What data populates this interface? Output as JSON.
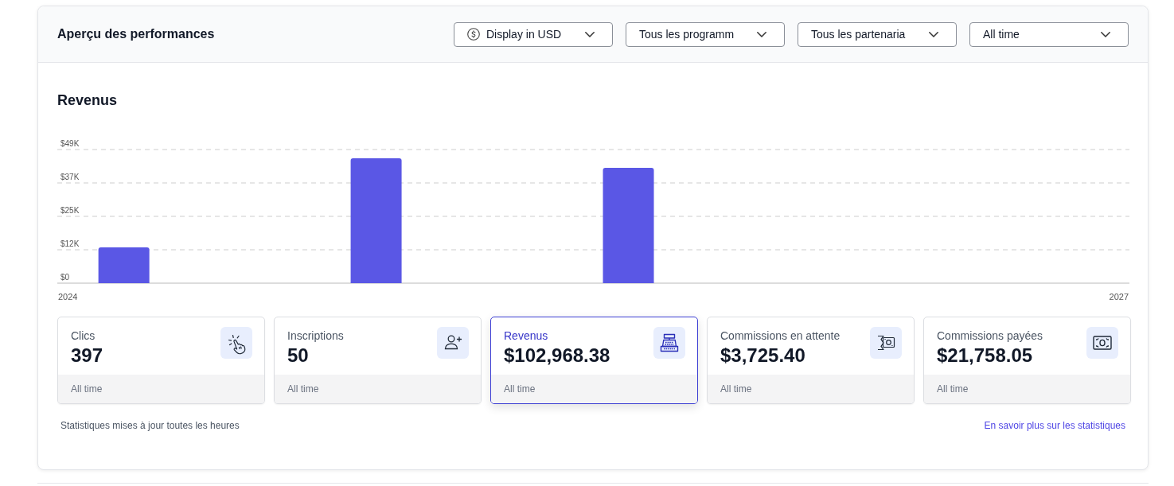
{
  "header": {
    "title": "Aperçu des performances",
    "filters": [
      {
        "kind": "currency",
        "label": "Display in USD"
      },
      {
        "kind": "select",
        "label": "Tous les programm"
      },
      {
        "kind": "select",
        "label": "Tous les partenaria"
      },
      {
        "kind": "select",
        "label": "All time"
      }
    ]
  },
  "revenue_chart": {
    "chart_data": {
      "type": "bar",
      "title": "Revenus",
      "x": [
        2024.16,
        2024.88,
        2025.6
      ],
      "values": [
        13100,
        45800,
        42300
      ],
      "xlim": [
        2023.97,
        2027.03
      ],
      "ylim": [
        0,
        49000
      ],
      "xticks": [
        {
          "value": 2024,
          "label": "2024"
        },
        {
          "value": 2027,
          "label": "2027"
        }
      ],
      "yticks": [
        {
          "value": 0,
          "label": "$0"
        },
        {
          "value": 12250,
          "label": "$12K"
        },
        {
          "value": 24500,
          "label": "$25K"
        },
        {
          "value": 36750,
          "label": "$37K"
        },
        {
          "value": 49000,
          "label": "$49K"
        }
      ],
      "grid": true
    }
  },
  "stats": [
    {
      "label": "Clics",
      "value": "397",
      "period": "All time",
      "selected": false
    },
    {
      "label": "Inscriptions",
      "value": "50",
      "period": "All time",
      "selected": false
    },
    {
      "label": "Revenus",
      "value": "$102,968.38",
      "period": "All time",
      "selected": true
    },
    {
      "label": "Commissions en attente",
      "value": "$3,725.40",
      "period": "All time",
      "selected": false
    },
    {
      "label": "Commissions payées",
      "value": "$21,758.05",
      "period": "All time",
      "selected": false
    }
  ],
  "footer": {
    "note": "Statistiques mises à jour toutes les heures",
    "link": "En savoir plus sur les statistiques"
  }
}
